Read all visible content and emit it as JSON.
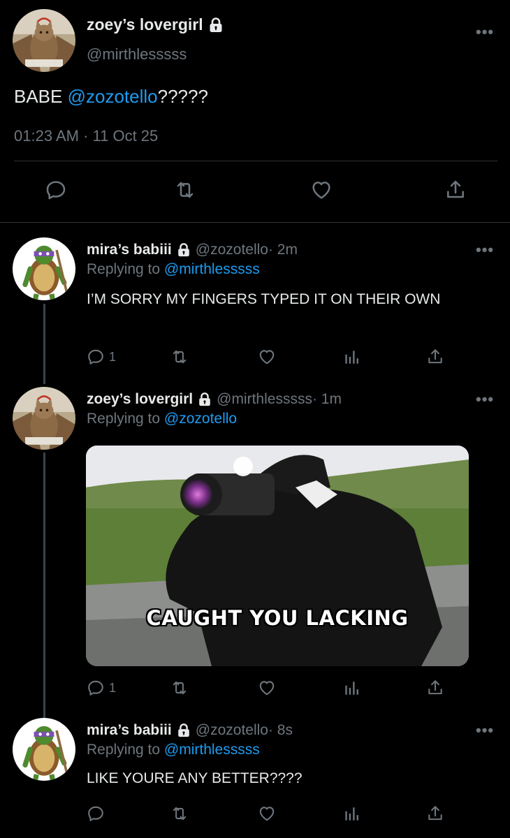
{
  "main_tweet": {
    "display_name": "zoey’s lovergirl",
    "handle": "@mirthlesssss",
    "text_prefix": "BABE ",
    "mention": "@zozotello",
    "text_suffix": "?????",
    "timestamp": "01:23 AM · 11 Oct 25",
    "more": "•••"
  },
  "replies": [
    {
      "display_name": "mira’s babiii",
      "handle": "@zozotello",
      "time": " · 2m",
      "replying_label": "Replying to ",
      "replying_to": "@mirthlesssss",
      "text": "I’M SORRY MY FINGERS TYPED IT ON THEIR OWN",
      "reply_count": "1",
      "more": "•••"
    },
    {
      "display_name": "zoey’s lovergirl",
      "handle": "@mirthlesssss",
      "time": " · 1m",
      "replying_label": "Replying to ",
      "replying_to": "@zozotello",
      "media_caption": "CAUGHT YOU LACKING",
      "reply_count": "1",
      "more": "•••"
    },
    {
      "display_name": "mira’s babiii",
      "handle": "@zozotello",
      "time": " · 8s",
      "replying_label": "Replying to ",
      "replying_to": "@mirthlesssss",
      "text": "LIKE YOURE ANY BETTER????",
      "more": "•••"
    }
  ],
  "colors": {
    "background": "#000000",
    "text": "#e7e9ea",
    "muted": "#6e767d",
    "link": "#1d9bf0",
    "divider": "#2f3336"
  }
}
